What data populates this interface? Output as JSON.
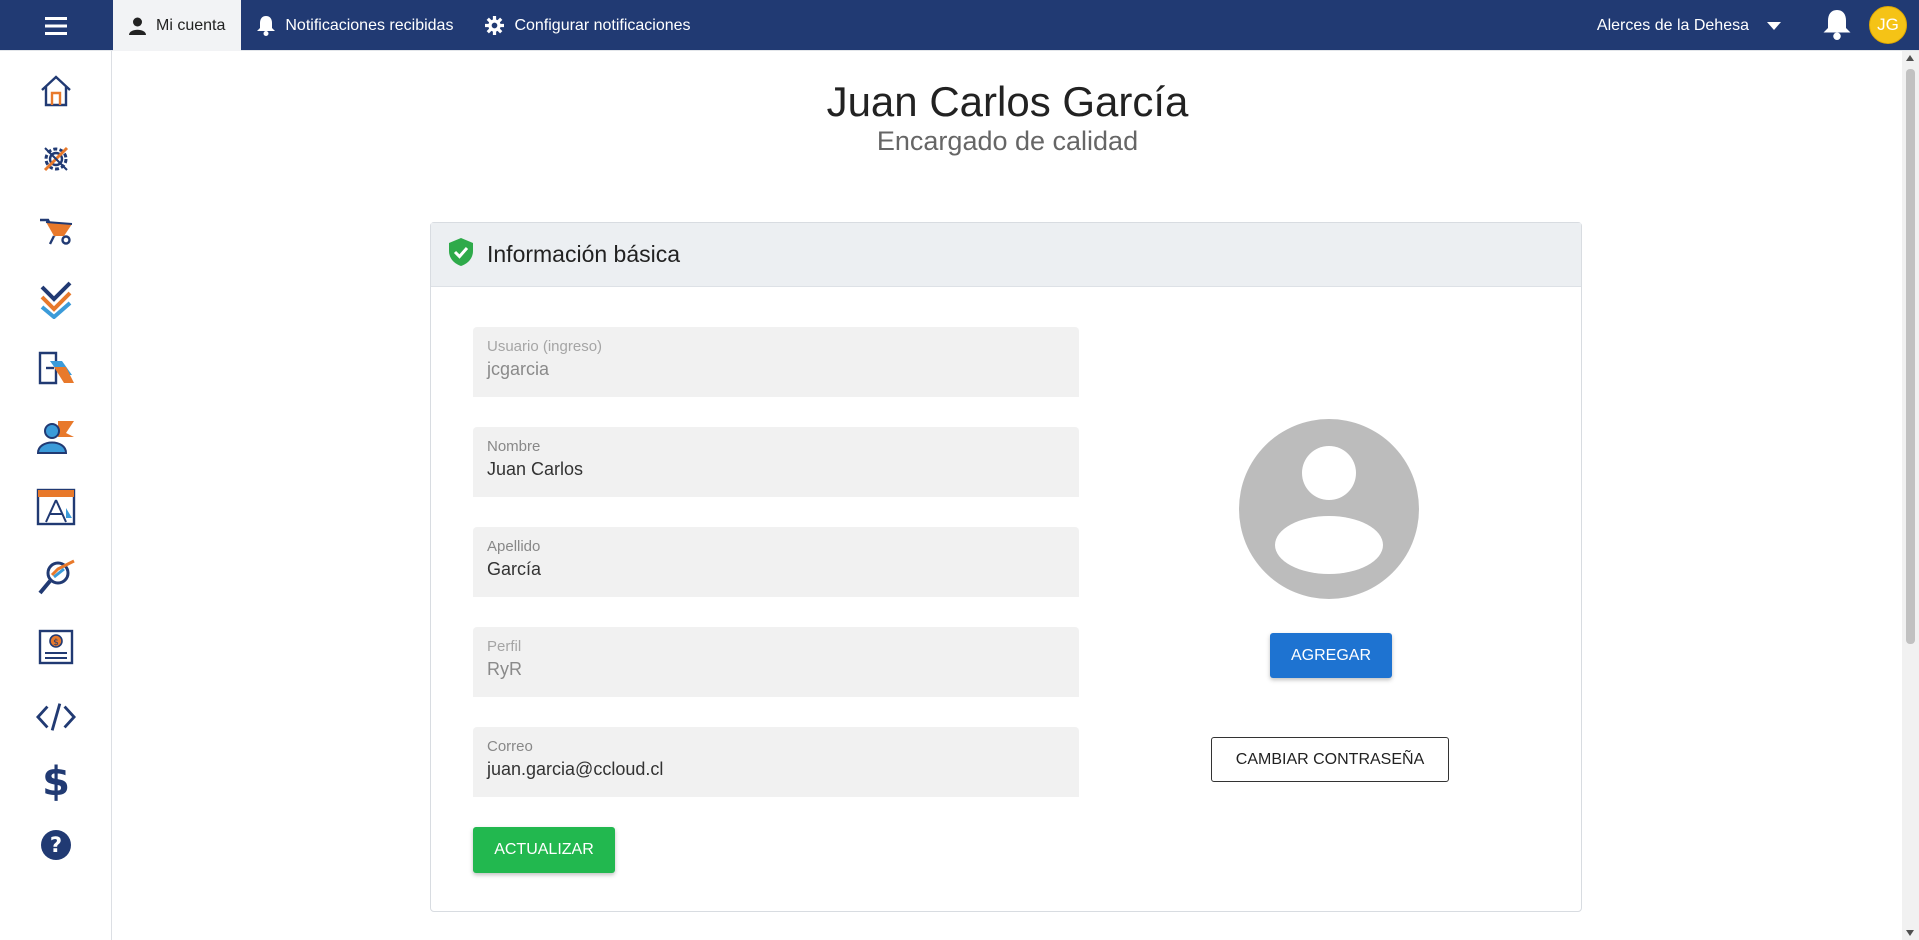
{
  "topbar": {
    "tabs": [
      {
        "label": "Mi cuenta",
        "icon": "user-icon",
        "active": true
      },
      {
        "label": "Notificaciones recibidas",
        "icon": "bell-icon",
        "active": false
      },
      {
        "label": "Configurar notificaciones",
        "icon": "gear-icon",
        "active": false
      }
    ],
    "company": "Alerces de la Dehesa",
    "user_initials": "JG",
    "colors": {
      "bar": "#213a73",
      "avatar": "#f5c316"
    }
  },
  "sidebar": {
    "items": [
      {
        "icon": "home-icon"
      },
      {
        "icon": "settings-tools-icon"
      },
      {
        "icon": "wheelbarrow-icon"
      },
      {
        "icon": "checklist-icon"
      },
      {
        "icon": "transfer-icon"
      },
      {
        "icon": "people-icon"
      },
      {
        "icon": "blueprint-icon"
      },
      {
        "icon": "inspection-icon"
      },
      {
        "icon": "budget-icon"
      },
      {
        "icon": "code-icon"
      },
      {
        "icon": "dollar-icon"
      },
      {
        "icon": "help-icon"
      }
    ]
  },
  "profile": {
    "name": "Juan Carlos García",
    "role": "Encargado de calidad"
  },
  "card": {
    "title": "Información básica",
    "fields": {
      "username": {
        "label": "Usuario (ingreso)",
        "value": "jcgarcia"
      },
      "first_name": {
        "label": "Nombre",
        "value": "Juan Carlos"
      },
      "last_name": {
        "label": "Apellido",
        "value": "García"
      },
      "profile": {
        "label": "Perfil",
        "value": "RyR"
      },
      "email": {
        "label": "Correo",
        "value": "juan.garcia@ccloud.cl"
      }
    },
    "update_button": "ACTUALIZAR",
    "add_button": "AGREGAR",
    "change_password_button": "CAMBIAR CONTRASEÑA"
  }
}
